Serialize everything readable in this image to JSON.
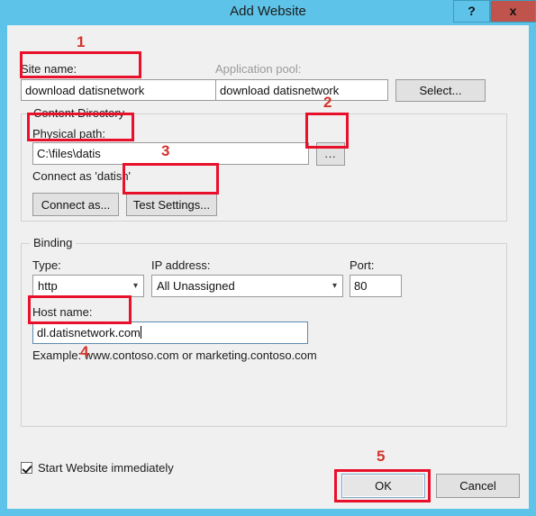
{
  "window": {
    "title": "Add Website",
    "help_label": "?",
    "close_label": "x"
  },
  "site": {
    "name_label": "Site name:",
    "name_value": "download datisnetwork",
    "app_pool_label": "Application pool:",
    "app_pool_value": "download datisnetwork",
    "select_label": "Select..."
  },
  "content_directory": {
    "group_label": "Content Directory",
    "physical_path_label": "Physical path:",
    "physical_path_value": "C:\\files\\datis",
    "browse_label": "...",
    "connect_as_status": "Connect as 'datisn'",
    "connect_as_label": "Connect as...",
    "test_settings_label": "Test Settings..."
  },
  "binding": {
    "group_label": "Binding",
    "type_label": "Type:",
    "type_value": "http",
    "ip_label": "IP address:",
    "ip_value": "All Unassigned",
    "port_label": "Port:",
    "port_value": "80",
    "host_label": "Host name:",
    "host_value": "dl.datisnetwork.com",
    "example_text": "Example: www.contoso.com or marketing.contoso.com"
  },
  "footer": {
    "start_website_label": "Start Website immediately",
    "ok_label": "OK",
    "cancel_label": "Cancel"
  },
  "annotations": {
    "one": "1",
    "two": "2",
    "three": "3",
    "four": "4",
    "five": "5"
  },
  "colors": {
    "titlebar": "#5ec3e8",
    "close_button": "#c0544d",
    "dialog_face": "#f0f0f0",
    "annotation_red": "#e8102a",
    "annotation_number": "#d2332c"
  }
}
